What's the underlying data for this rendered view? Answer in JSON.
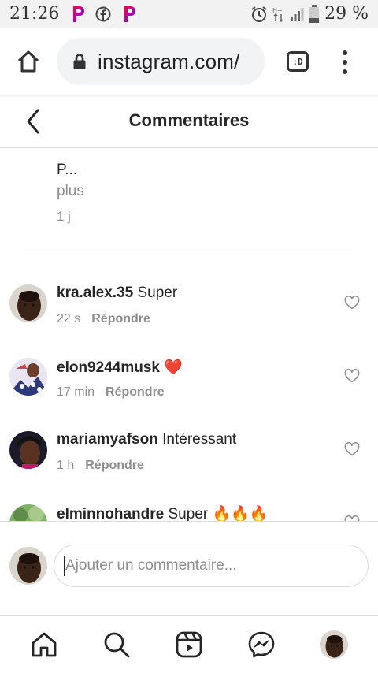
{
  "status_bar": {
    "time": "21:26",
    "battery": "29 %"
  },
  "browser": {
    "url": "instagram.com/",
    "tabs_label": ":D"
  },
  "header": {
    "title": "Commentaires"
  },
  "caption": {
    "text": "P...",
    "more": "plus",
    "time": "1 j"
  },
  "comments": [
    {
      "username": "kra.alex.35",
      "text": "Super",
      "time": "22 s",
      "reply": "Répondre"
    },
    {
      "username": "elon9244musk",
      "text": "❤️",
      "time": "17 min",
      "reply": "Répondre"
    },
    {
      "username": "mariamyafson",
      "text": "Intéressant",
      "time": "1 h",
      "reply": "Répondre"
    },
    {
      "username": "elminnohandre",
      "text": "Super 🔥🔥🔥",
      "time": "",
      "reply": ""
    }
  ],
  "comment_input": {
    "placeholder": "Ajouter un commentaire..."
  },
  "colors": {
    "text": "#262626",
    "secondary": "#8e8e8e",
    "divider": "#dbdbdb",
    "heart_red": "#e0245e"
  }
}
